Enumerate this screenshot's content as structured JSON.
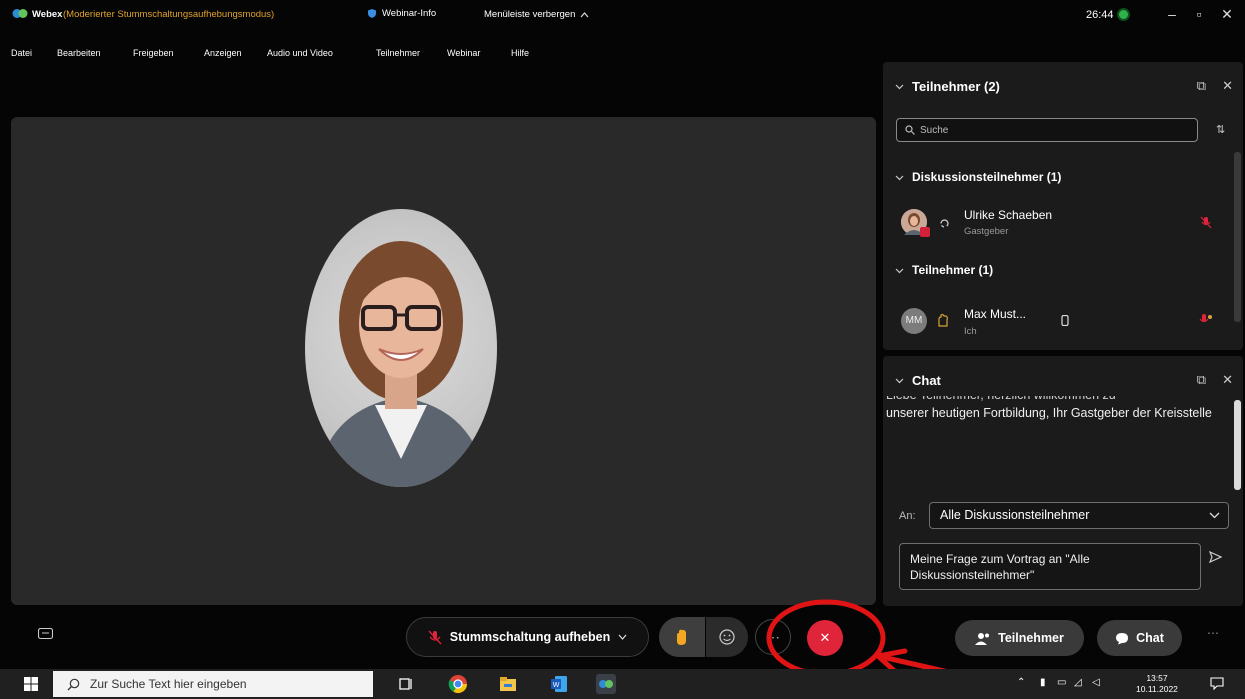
{
  "window": {
    "app_name": "Webex",
    "mode_label": "(Moderierter Stummschaltungsaufhebungsmodus)",
    "webinar_info": "Webinar-Info",
    "hide_menu": "Menüleiste verbergen",
    "timer": "26:44"
  },
  "menu": [
    "Datei",
    "Bearbeiten",
    "Freigeben",
    "Anzeigen",
    "Audio und Video",
    "Teilnehmer",
    "Webinar",
    "Hilfe"
  ],
  "participants_panel": {
    "title": "Teilnehmer (2)",
    "search_placeholder": "Suche",
    "sections": [
      {
        "title": "Diskussionsteilnehmer (1)",
        "people": [
          {
            "name": "Ulrike Schaeben",
            "role": "Gastgeber"
          }
        ]
      },
      {
        "title": "Teilnehmer (1)",
        "people": [
          {
            "name": "Max Must...",
            "role": "Ich",
            "initials": "MM"
          }
        ]
      }
    ]
  },
  "chat_panel": {
    "title": "Chat",
    "message_first_line": "Liebe Teilnehmer, herzlich willkommen zu",
    "message": "unserer heutigen Fortbildung, Ihr Gastgeber der Kreisstelle",
    "to_label": "An:",
    "to_value": "Alle Diskussionsteilnehmer",
    "input_text": "Meine Frage zum Vortrag an \"Alle Diskussionsteilnehmer\""
  },
  "toolbar": {
    "unmute_label": "Stummschaltung aufheben",
    "participants_label": "Teilnehmer",
    "chat_label": "Chat"
  },
  "taskbar": {
    "search_placeholder": "Zur Suche Text hier eingeben",
    "time": "13:57",
    "date": "10.11.2022"
  },
  "colors": {
    "mode_text": "#e0a32e",
    "leave_button": "#e0243a",
    "annotation": "#e01414",
    "panel_bg": "#1b1b1b"
  }
}
